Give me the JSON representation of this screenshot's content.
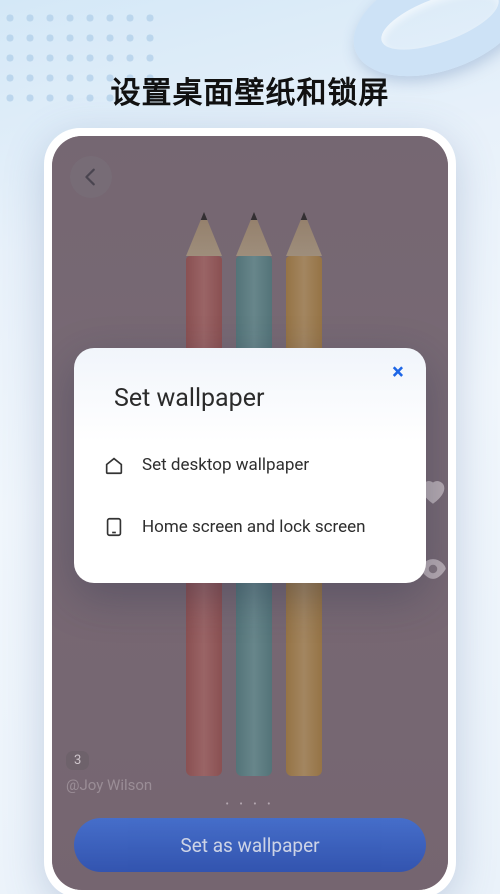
{
  "page": {
    "title": "设置桌面壁纸和锁屏"
  },
  "screen": {
    "count_badge": "3",
    "author": "@Joy Wilson",
    "primary_button": "Set as wallpaper"
  },
  "modal": {
    "title": "Set wallpaper",
    "close_glyph": "×",
    "options": [
      {
        "label": "Set desktop wallpaper"
      },
      {
        "label": "Home screen and lock screen"
      }
    ]
  },
  "icons": {
    "back": "arrow-left-icon",
    "like": "heart-icon",
    "view": "eye-icon",
    "home": "home-icon",
    "device": "device-icon"
  }
}
